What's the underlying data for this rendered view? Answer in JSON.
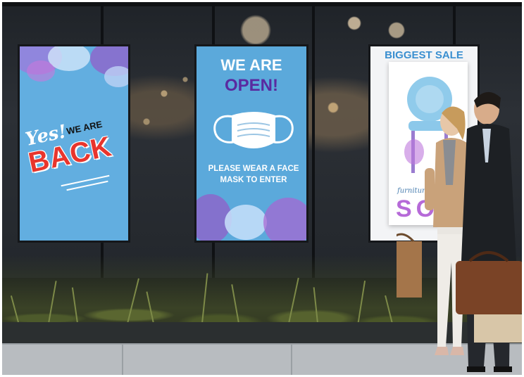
{
  "scene": {
    "description_alt": "Storefront with three digital signs and two pedestrians with bags"
  },
  "signs": {
    "back": {
      "yes": "Yes!",
      "we_are": "WE ARE",
      "back": "BACK"
    },
    "open": {
      "line1": "WE ARE",
      "line2": "OPEN!",
      "mask_text": "PLEASE WEAR A FACE MASK TO ENTER"
    },
    "sale": {
      "title": "BIGGEST SALE",
      "small": "furniture",
      "big": "SO"
    }
  },
  "colors": {
    "sign_blue": "#62aee0",
    "back_red": "#e8352d",
    "open_purple": "#5a2aa0",
    "sale_blue": "#3a8fd0",
    "sale_purple": "#b66ad8"
  }
}
